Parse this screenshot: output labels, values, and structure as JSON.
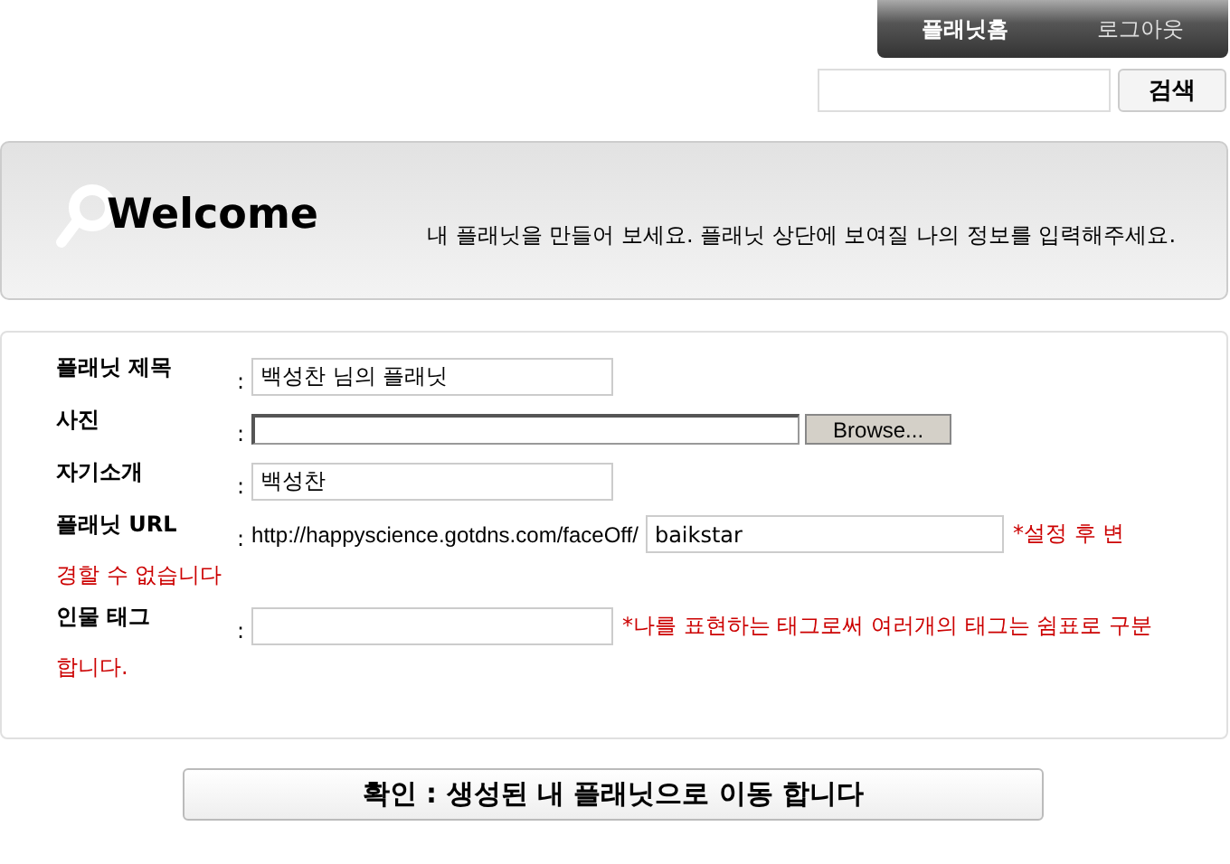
{
  "nav": [
    {
      "label": "플래닛홈",
      "selected": true
    },
    {
      "label": "로그아웃",
      "selected": false
    }
  ],
  "search": {
    "button": "검색"
  },
  "welcome": {
    "title": "Welcome",
    "message": "내 플래닛을 만들어 보세요. 플래닛 상단에 보여질 나의 정보를 입력해주세요."
  },
  "form": {
    "rows": [
      {
        "label": "플래닛 제목",
        "separator": ":",
        "kind": "text",
        "value": "백성찬 님의 플래닛"
      },
      {
        "label": "사진",
        "separator": ":",
        "kind": "file",
        "button": "Browse..."
      },
      {
        "label": "자기소개",
        "separator": ":",
        "kind": "text",
        "value": "백성찬"
      },
      {
        "label": "플래닛 URL",
        "separator": ":",
        "kind": "url",
        "prefix": "http://happyscience.gotdns.com/faceOff/",
        "value": "baikstar",
        "note_lines": [
          "*설정 후 변",
          "경할 수 없습니다"
        ]
      },
      {
        "label": "인물 태그",
        "separator": ":",
        "kind": "text",
        "note_lines": [
          "*나를 표현하는 태그로써 여러개의 태그는 쉼표로 구분",
          "합니다."
        ]
      }
    ]
  },
  "submit": "확인 : 생성된 내 플래닛으로 이동 합니다"
}
